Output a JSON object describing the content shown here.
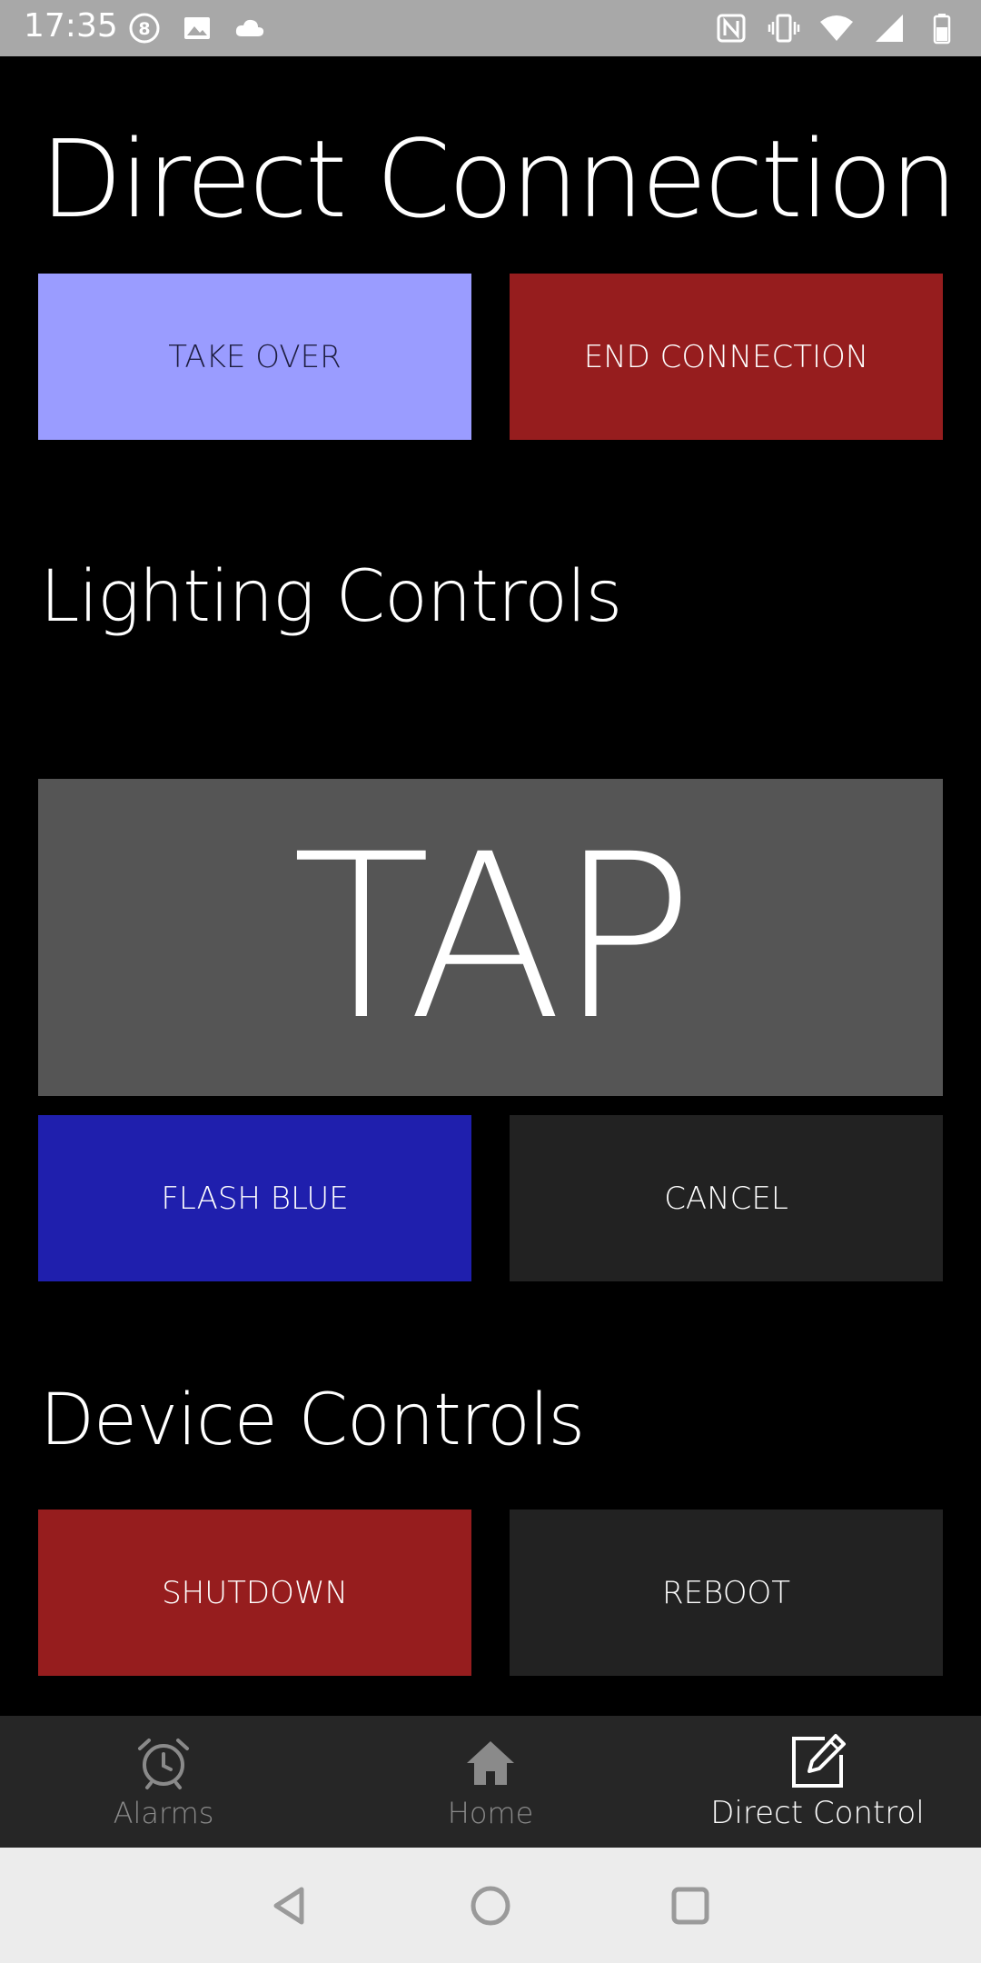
{
  "status_bar": {
    "time": "17:35",
    "left_icons": [
      "notification-8-icon",
      "image-icon",
      "cloud-icon"
    ],
    "right_icons": [
      "nfc-icon",
      "vibrate-icon",
      "wifi-icon",
      "signal-icon",
      "battery-icon"
    ]
  },
  "sections": {
    "direct_connection": {
      "title": "Direct Connection",
      "take_over_label": "TAKE OVER",
      "end_connection_label": "END CONNECTION"
    },
    "lighting_controls": {
      "title": "Lighting Controls",
      "tap_label": "TAP",
      "flash_blue_label": "FLASH BLUE",
      "cancel_label": "CANCEL"
    },
    "device_controls": {
      "title": "Device Controls",
      "shutdown_label": "SHUTDOWN",
      "reboot_label": "REBOOT"
    }
  },
  "bottom_nav": {
    "items": [
      {
        "label": "Alarms",
        "icon": "alarm-clock-icon",
        "active": false
      },
      {
        "label": "Home",
        "icon": "home-icon",
        "active": false
      },
      {
        "label": "Direct Control",
        "icon": "edit-icon",
        "active": true
      }
    ]
  },
  "colors": {
    "take_over": "#9a9cff",
    "end_connection": "#961d1e",
    "tap": "#555555",
    "flash_blue": "#1f1fad",
    "neutral_button": "#222222",
    "shutdown": "#961d1e",
    "nav_background": "#262626",
    "status_bar": "#a8a8a8"
  },
  "system_nav": {
    "buttons": [
      "back-icon",
      "home-circle-icon",
      "recents-icon"
    ]
  }
}
